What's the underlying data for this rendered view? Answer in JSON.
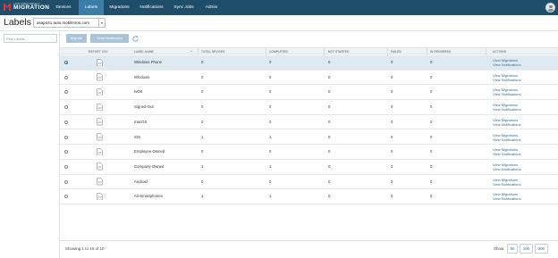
{
  "nav": {
    "brand_top": "LOW USER IMPACT",
    "brand_main": "MIGRATION",
    "tabs": [
      {
        "label": "Devices",
        "active": false
      },
      {
        "label": "Labels",
        "active": true
      },
      {
        "label": "Migrations",
        "active": false
      },
      {
        "label": "Notifications",
        "active": false
      },
      {
        "label": "Sync Jobs",
        "active": false
      },
      {
        "label": "Admin",
        "active": false
      }
    ],
    "user_icon": "user-avatar-icon"
  },
  "header": {
    "title": "Labels",
    "server_selected": "asap441.auto.mobileiron.com"
  },
  "sidebar": {
    "search_placeholder": "Find Labels..."
  },
  "toolbar": {
    "migrate_label": "Migrate",
    "send_notification_label": "Send Notification",
    "refresh_icon": "refresh-icon"
  },
  "table": {
    "columns": [
      "EXPORT CSV",
      "LABEL NAME",
      "TOTAL DEVICES",
      "COMPLETED",
      "NOT STARTED",
      "FAILED",
      "IN PROGRESS",
      "ACTIONS"
    ],
    "action_labels": {
      "view_migrations": "View Migrations",
      "view_notifications": "View Notifications"
    },
    "rows": [
      {
        "label_name": "Windows Phone",
        "total_devices": "0",
        "completed": "0",
        "not_started": "0",
        "failed": "0",
        "in_progress": "0",
        "selected": true
      },
      {
        "label_name": "Windows",
        "total_devices": "0",
        "completed": "0",
        "not_started": "0",
        "failed": "0",
        "in_progress": "0",
        "selected": false
      },
      {
        "label_name": "tvOS",
        "total_devices": "0",
        "completed": "0",
        "not_started": "0",
        "failed": "0",
        "in_progress": "0",
        "selected": false
      },
      {
        "label_name": "Signed-Out",
        "total_devices": "0",
        "completed": "0",
        "not_started": "0",
        "failed": "0",
        "in_progress": "0",
        "selected": false
      },
      {
        "label_name": "macOS",
        "total_devices": "0",
        "completed": "0",
        "not_started": "0",
        "failed": "0",
        "in_progress": "0",
        "selected": false
      },
      {
        "label_name": "iOS",
        "total_devices": "1",
        "completed": "1",
        "not_started": "0",
        "failed": "0",
        "in_progress": "0",
        "selected": false
      },
      {
        "label_name": "Employee-Owned",
        "total_devices": "0",
        "completed": "0",
        "not_started": "0",
        "failed": "0",
        "in_progress": "0",
        "selected": false
      },
      {
        "label_name": "Company-Owned",
        "total_devices": "1",
        "completed": "1",
        "not_started": "0",
        "failed": "0",
        "in_progress": "0",
        "selected": false
      },
      {
        "label_name": "Android",
        "total_devices": "0",
        "completed": "0",
        "not_started": "0",
        "failed": "0",
        "in_progress": "0",
        "selected": false
      },
      {
        "label_name": "All-Smartphones",
        "total_devices": "1",
        "completed": "1",
        "not_started": "0",
        "failed": "0",
        "in_progress": "0",
        "selected": false
      }
    ]
  },
  "footer": {
    "showing_text": "Showing 1 to 10 of 10",
    "show_label": "Show",
    "page_sizes": [
      "50",
      "100",
      "200"
    ]
  },
  "colors": {
    "navbar": "#1f4e6b",
    "active_tab": "#3d7ea8",
    "brand_accent": "#d9363e",
    "link": "#2f6f9f",
    "disabled_button": "#a9c3d8"
  }
}
